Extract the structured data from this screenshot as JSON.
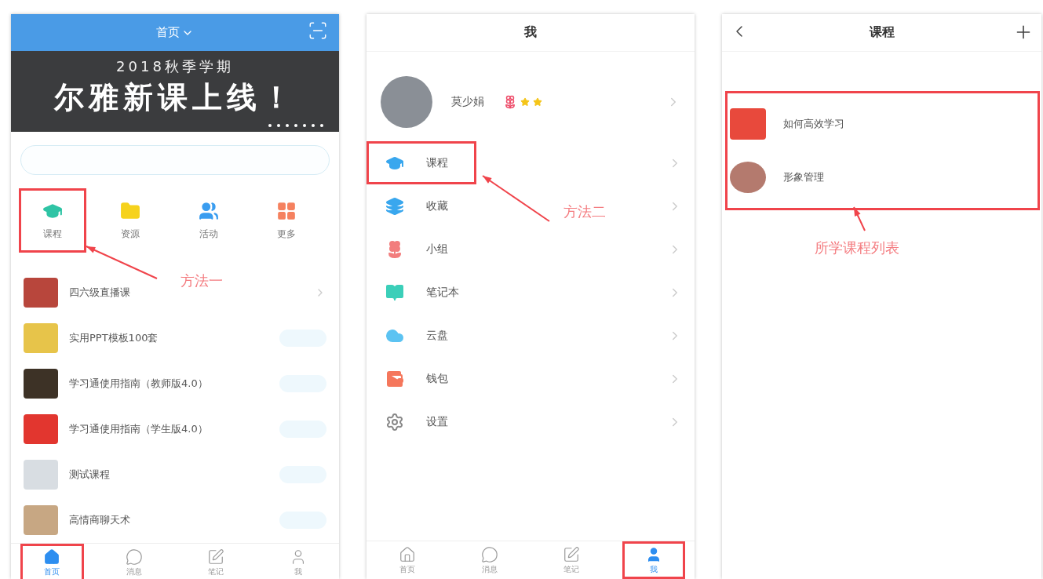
{
  "home_screen": {
    "title": "首页",
    "banner": {
      "subtitle": "2018秋季学期",
      "headline": "尔雅新课上线！"
    },
    "quick_links": [
      {
        "label": "课程",
        "highlighted": true
      },
      {
        "label": "资源",
        "highlighted": false
      },
      {
        "label": "活动",
        "highlighted": false
      },
      {
        "label": "更多",
        "highlighted": false
      }
    ],
    "courses": [
      {
        "title": "四六级直播课",
        "kind": "link"
      },
      {
        "title": "实用PPT模板100套",
        "kind": "action"
      },
      {
        "title": "学习通使用指南（教师版4.0）",
        "kind": "action"
      },
      {
        "title": "学习通使用指南（学生版4.0）",
        "kind": "action"
      },
      {
        "title": "测试课程",
        "kind": "action"
      },
      {
        "title": "高情商聊天术",
        "kind": "action"
      }
    ],
    "tabs": [
      {
        "label": "首页",
        "selected": true,
        "highlighted": true
      },
      {
        "label": "消息",
        "selected": false,
        "highlighted": false
      },
      {
        "label": "笔记",
        "selected": false,
        "highlighted": false
      },
      {
        "label": "我",
        "selected": false,
        "highlighted": false
      }
    ],
    "annotation": "方法一"
  },
  "me_screen": {
    "title": "我",
    "profile": {
      "name": "莫少娟"
    },
    "menu": [
      {
        "label": "课程",
        "highlighted": true
      },
      {
        "label": "收藏",
        "highlighted": false
      },
      {
        "label": "小组",
        "highlighted": false
      },
      {
        "label": "笔记本",
        "highlighted": false
      },
      {
        "label": "云盘",
        "highlighted": false
      },
      {
        "label": "钱包",
        "highlighted": false
      },
      {
        "label": "设置",
        "highlighted": false
      }
    ],
    "tabs": [
      {
        "label": "首页",
        "selected": false,
        "highlighted": false
      },
      {
        "label": "消息",
        "selected": false,
        "highlighted": false
      },
      {
        "label": "笔记",
        "selected": false,
        "highlighted": false
      },
      {
        "label": "我",
        "selected": true,
        "highlighted": true
      }
    ],
    "annotation": "方法二"
  },
  "courses_screen": {
    "title": "课程",
    "list_highlighted": true,
    "courses": [
      {
        "title": "如何高效学习"
      },
      {
        "title": "形象管理"
      }
    ],
    "annotation": "所学课程列表"
  }
}
